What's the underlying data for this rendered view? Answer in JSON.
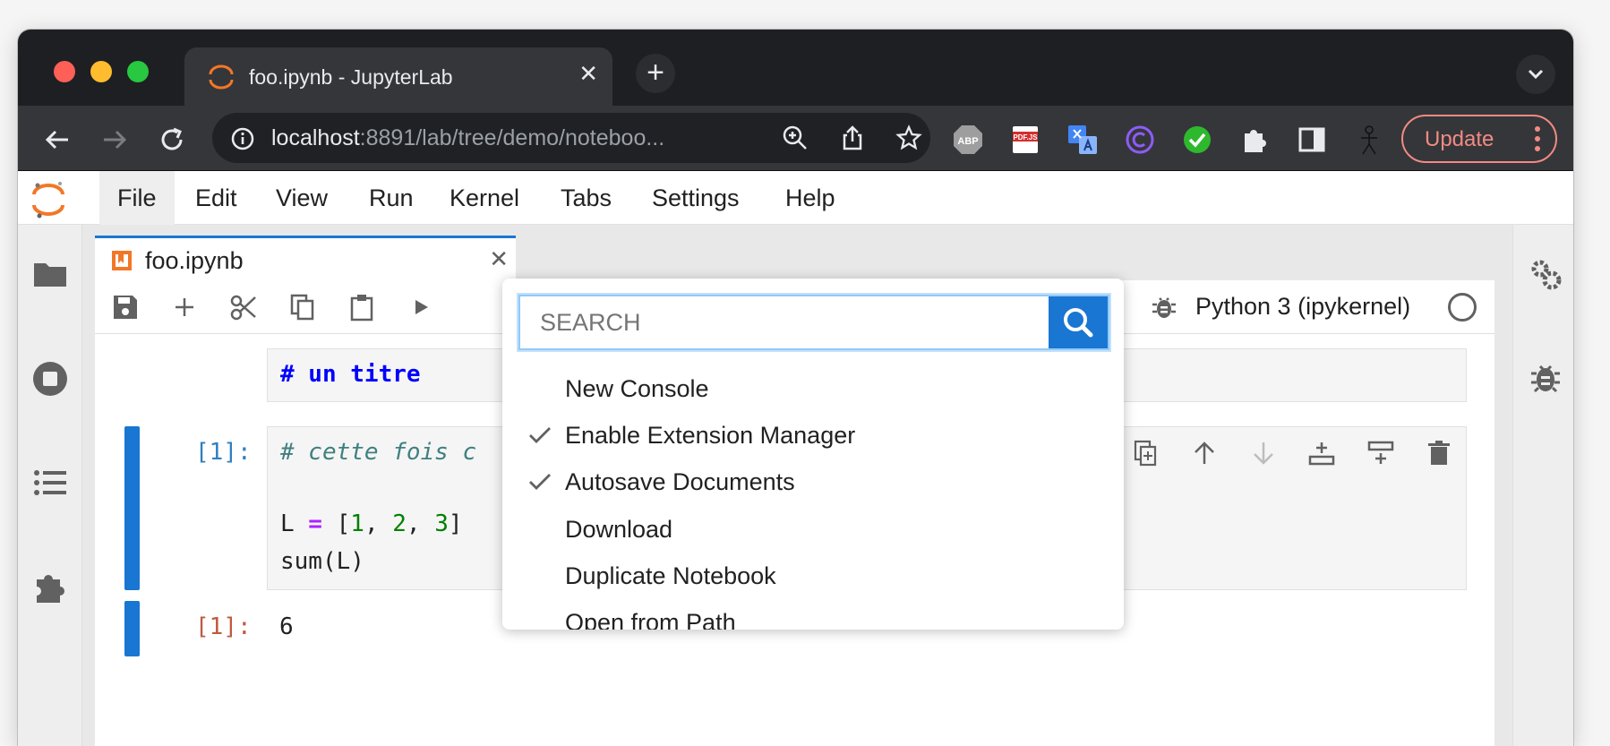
{
  "browser": {
    "tab_title": "foo.ipynb - JupyterLab",
    "url_host": "localhost",
    "url_rest": ":8891/lab/tree/demo/noteboo...",
    "update_label": "Update",
    "extensions": [
      "adblock-plus-icon",
      "pdfjs-icon",
      "translate-icon",
      "c-icon",
      "checkmark-icon",
      "puzzle-icon",
      "sidepanel-icon",
      "stickfigure-icon"
    ],
    "ext_abp_label": "ABP",
    "ext_pdf_label": "PDF.JS"
  },
  "jupyter": {
    "menu": [
      "File",
      "Edit",
      "View",
      "Run",
      "Kernel",
      "Tabs",
      "Settings",
      "Help"
    ],
    "notebook_tab": "foo.ipynb",
    "kernel_name": "Python 3 (ipykernel)",
    "cells": {
      "markdown_text": "# un titre",
      "code_prompt": "[1]:",
      "code_comment": "# cette fois c",
      "code_line2_L": "L",
      "code_line2_eq": " = ",
      "code_line2_br": "[",
      "code_line2_n1": "1",
      "code_line2_n2": "2",
      "code_line2_n3": "3",
      "code_line2_end": "]",
      "code_line3": "sum(L)",
      "output_prompt": "[1]:",
      "output_value": "6"
    }
  },
  "palette": {
    "search_placeholder": "SEARCH",
    "items": [
      {
        "label": "New Console",
        "checked": false
      },
      {
        "label": "Enable Extension Manager",
        "checked": true
      },
      {
        "label": "Autosave Documents",
        "checked": true
      },
      {
        "label": "Download",
        "checked": false
      },
      {
        "label": "Duplicate Notebook",
        "checked": false
      },
      {
        "label": "Open from Path",
        "checked": false
      }
    ]
  },
  "colors": {
    "accent": "#1976d2",
    "jupyter_orange": "#f37726",
    "update": "#f28b82"
  }
}
